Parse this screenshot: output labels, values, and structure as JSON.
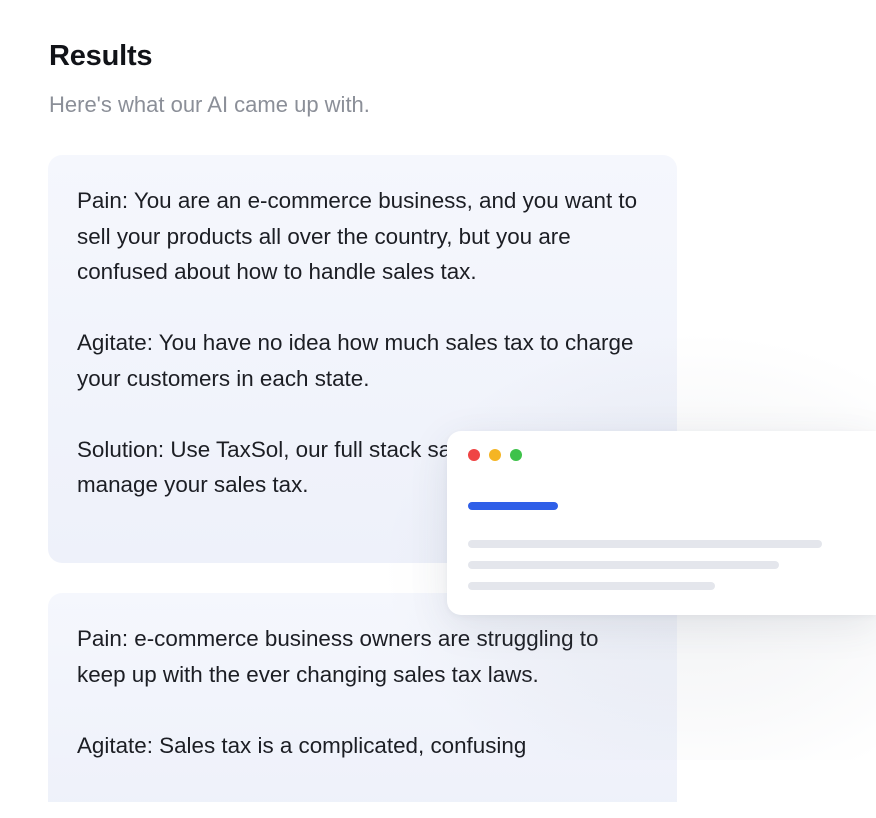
{
  "header": {
    "title": "Results",
    "subtitle": "Here's what our AI came up with."
  },
  "results": [
    {
      "paragraphs": [
        "Pain: You are an e-commerce business, and you want to sell your products all over the country, but you are confused about how to handle sales tax.",
        "Agitate: You have no idea how much sales tax to charge your customers in each state.",
        "Solution: Use TaxSol, our full stack sales tax solution, to manage your sales tax."
      ]
    },
    {
      "paragraphs": [
        "Pain: e-commerce business owners are struggling to keep up with the ever changing sales tax laws.",
        "Agitate: Sales tax is a complicated, confusing"
      ]
    }
  ],
  "mockup": {
    "icons": [
      "window-close-dot",
      "window-minimize-dot",
      "window-maximize-dot"
    ],
    "colors": {
      "dot_red": "#ef4444",
      "dot_yellow": "#f5b524",
      "dot_green": "#3ec24a",
      "accent": "#2f5fe8"
    }
  }
}
